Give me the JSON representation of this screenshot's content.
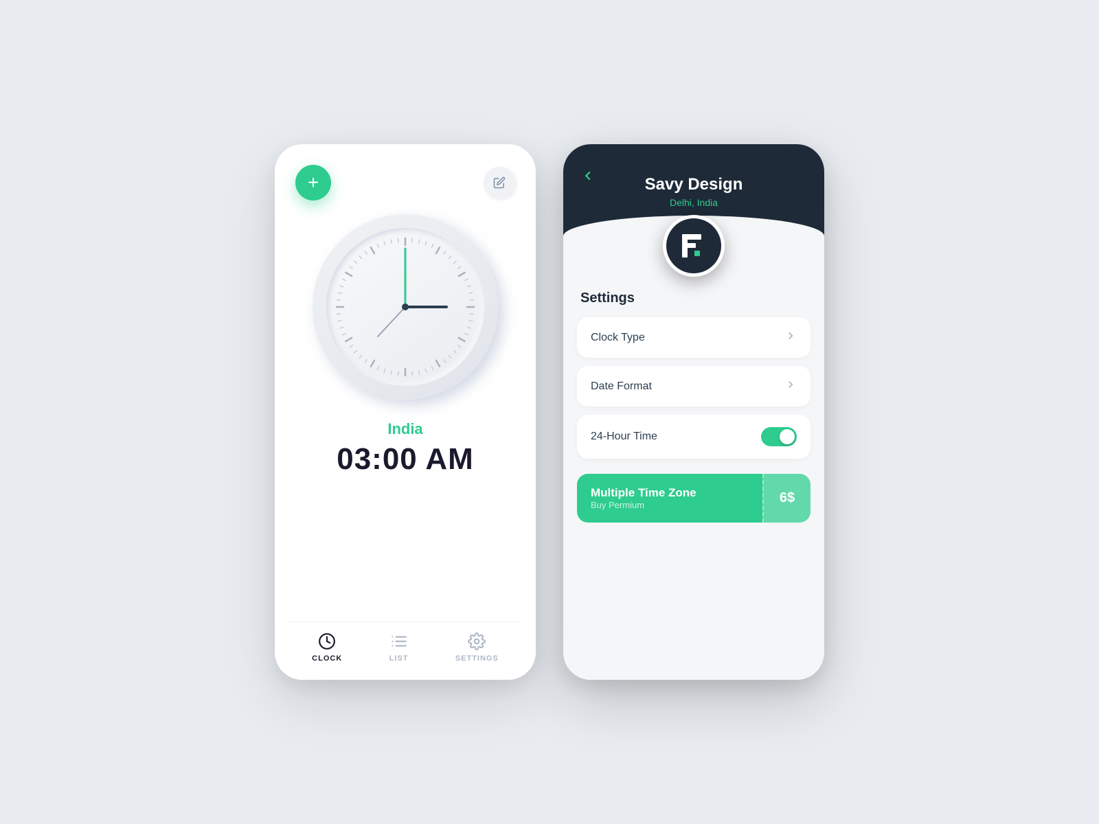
{
  "left_phone": {
    "add_button_label": "+",
    "location_label": "India",
    "time_label": "03:00 AM",
    "nav_items": [
      {
        "id": "clock",
        "label": "CLOCK",
        "active": true
      },
      {
        "id": "list",
        "label": "LIST",
        "active": false
      },
      {
        "id": "settings",
        "label": "SETTINGS",
        "active": false
      }
    ]
  },
  "right_phone": {
    "back_label": "←",
    "profile_name": "Savy Design",
    "profile_location": "Delhi, India",
    "settings_title": "Settings",
    "settings_items": [
      {
        "id": "clock-type",
        "label": "Clock Type",
        "type": "chevron"
      },
      {
        "id": "date-format",
        "label": "Date Format",
        "type": "chevron"
      },
      {
        "id": "24hour-time",
        "label": "24-Hour Time",
        "type": "toggle",
        "enabled": true
      }
    ],
    "premium_title": "Multiple Time Zone",
    "premium_subtitle": "Buy Permium",
    "premium_price": "6$"
  }
}
